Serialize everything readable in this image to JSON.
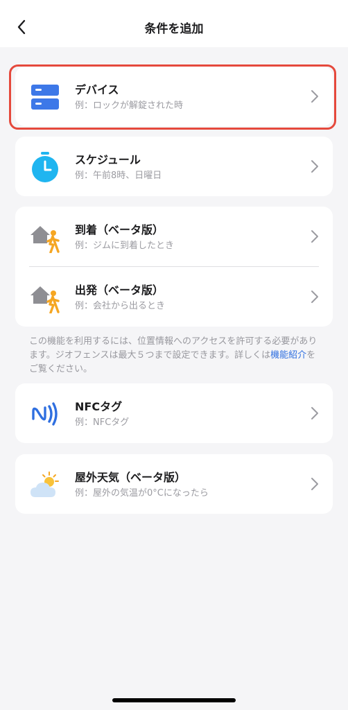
{
  "header": {
    "title": "条件を追加",
    "back_icon": "chevron-left-icon"
  },
  "items": {
    "device": {
      "title": "デバイス",
      "subtitle": "例：ロックが解錠された時",
      "icon": "device-icon"
    },
    "schedule": {
      "title": "スケジュール",
      "subtitle": "例：午前8時、日曜日",
      "icon": "stopwatch-icon"
    },
    "arrive": {
      "title": "到着（ベータ版）",
      "subtitle": "例：ジムに到着したとき",
      "icon": "arrive-home-icon"
    },
    "leave": {
      "title": "出発（ベータ版）",
      "subtitle": "例：会社から出るとき",
      "icon": "leave-home-icon"
    },
    "nfc": {
      "title": "NFCタグ",
      "subtitle": "例：NFCタグ",
      "icon": "nfc-icon"
    },
    "weather": {
      "title": "屋外天気（ベータ版）",
      "subtitle": "例：屋外の気温が0°Cになったら",
      "icon": "weather-icon"
    }
  },
  "location_note": {
    "text": "この機能を利用するには、位置情報へのアクセスを許可する必要があります。ジオフェンスは最大５つまで設定できます。詳しくは",
    "link": "機能紹介",
    "suffix": "をご覧ください。"
  },
  "colors": {
    "accent": "#2f6fe0",
    "highlight": "#e5493c",
    "device_icon": "#3d78e8",
    "stopwatch": "#1fb5f0",
    "person": "#f5a623",
    "house": "#8e8e93"
  }
}
